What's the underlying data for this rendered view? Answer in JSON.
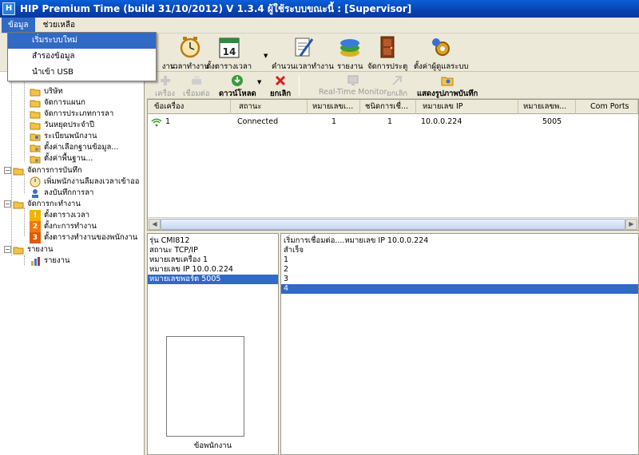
{
  "title": "HIP Premium Time (build 31/10/2012) V 1.3.4    ผู้ใช้ระบบขณะนี้  : [Supervisor]",
  "menu": {
    "items": [
      "ข้อมูล",
      "ช่วยเหลือ"
    ],
    "dropdown": [
      "เริ่มระบบใหม่",
      "สำรองข้อมูล",
      "นำเข้า USB"
    ]
  },
  "toolbar": {
    "partial_left": "งาน",
    "items": [
      "เวลาทำงาน",
      "ตั้งตารางเวลา",
      "คำนวนเวลาทำงาน",
      "รายงาน",
      "จัดการประตู",
      "ตั้งค่าผู้ดูแลระบบ"
    ],
    "calendar_day": "14"
  },
  "device_toolbar": {
    "items": [
      "เครื่อง",
      "เชื่อมต่อ",
      "ดาวน์โหลด",
      "ยกเลิก",
      "Real-Time Monitor",
      "ยกเลิก",
      "แสดงรูปภาพบันทึก"
    ]
  },
  "tree": {
    "items": [
      "บริษัท",
      "จัดการแผนก",
      "จัดการประเภทการลา",
      "วันหยุดประจำปี",
      "ระเบียนพนักงาน",
      "ตั้งค่าเลือกฐานข้อมูล...",
      "ตั้งค่าพื้นฐาน...",
      "จัดการการบันทึก",
      "เพิ่มพนักงานลืมลงเวลาเข้าออ",
      "ลงบันทึกการลา",
      "จัดการกะทำงาน",
      "ตั้งตารางเวลา",
      "ตั้งกะการทำงาน",
      "ตั้งตารางทำงานของพนักงาน",
      "รายงาน",
      "รายงาน"
    ],
    "badges": [
      "!",
      "2",
      "3"
    ]
  },
  "grid": {
    "headers": [
      "ข้อเครื่อง",
      "สถานะ",
      "หมายเลขเ...",
      "ชนิดการเชื่...",
      "หมายเลข IP",
      "หมายเลขพ...",
      "Com Ports"
    ],
    "rows": [
      [
        "1",
        "Connected",
        "1",
        "1",
        "10.0.0.224",
        "5005",
        ""
      ]
    ]
  },
  "info": {
    "lines": [
      "รุ่น  CMI812",
      "สถานะ  TCP/IP",
      "หมายเลขเครื่อง  1",
      "หมายเลข IP   10.0.0.224",
      "หมายเลขพอร์ต  5005"
    ],
    "photo_label": "ข้อพนักงาน"
  },
  "log": {
    "lines": [
      "เริ่มการเชื่อมต่อ....หมายเลข IP   10.0.0.224",
      "สำเร็จ",
      "1",
      "2",
      "3",
      "4"
    ]
  },
  "colors": {
    "title_bar": "#0842b0",
    "selection": "#316ac5"
  }
}
